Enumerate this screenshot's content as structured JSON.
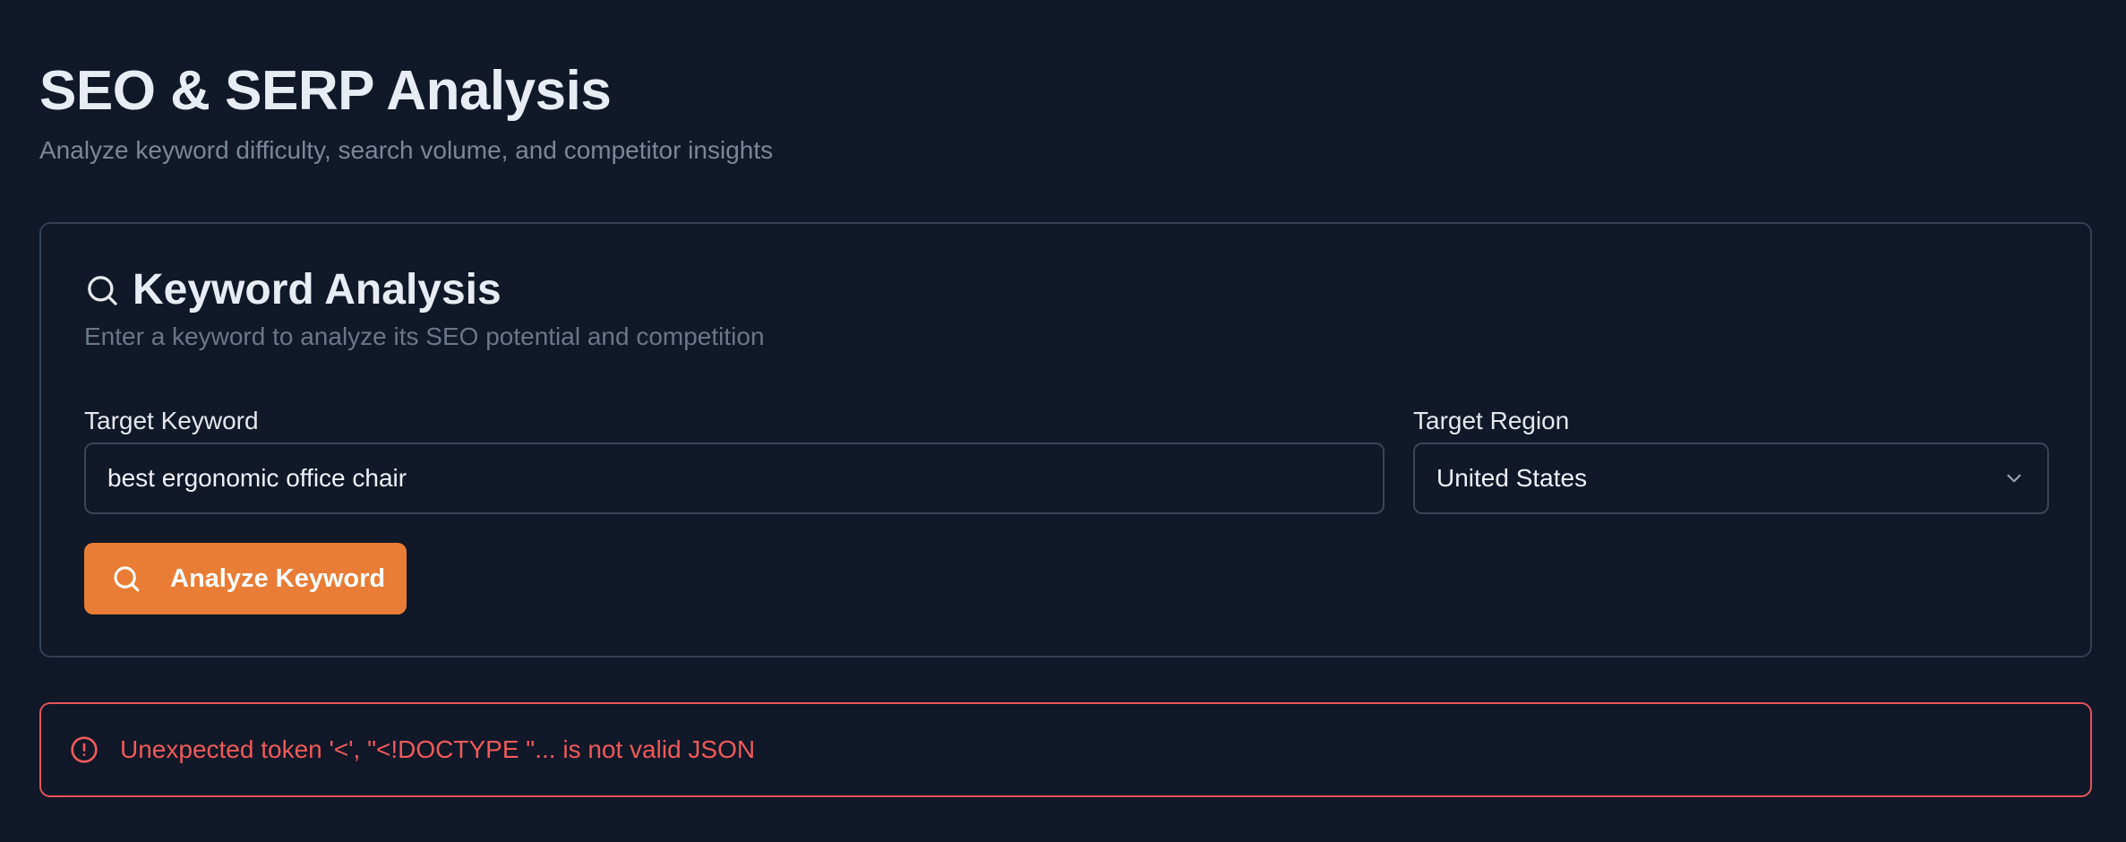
{
  "page": {
    "title": "SEO & SERP Analysis",
    "subtitle": "Analyze keyword difficulty, search volume, and competitor insights"
  },
  "card": {
    "title": "Keyword Analysis",
    "subtitle": "Enter a keyword to analyze its SEO potential and competition",
    "title_icon": "search-icon"
  },
  "form": {
    "keyword_label": "Target Keyword",
    "keyword_value": "best ergonomic office chair",
    "region_label": "Target Region",
    "region_value": "United States",
    "region_icon": "chevron-down-icon",
    "analyze_button_label": "Analyze Keyword",
    "analyze_button_icon": "search-icon"
  },
  "error": {
    "icon": "alert-circle-icon",
    "message": "Unexpected token '<', \"<!DOCTYPE \"... is not valid JSON"
  },
  "colors": {
    "background": "#111827",
    "accent": "#e97d35",
    "error": "#ef5a5a",
    "border": "#344154"
  }
}
